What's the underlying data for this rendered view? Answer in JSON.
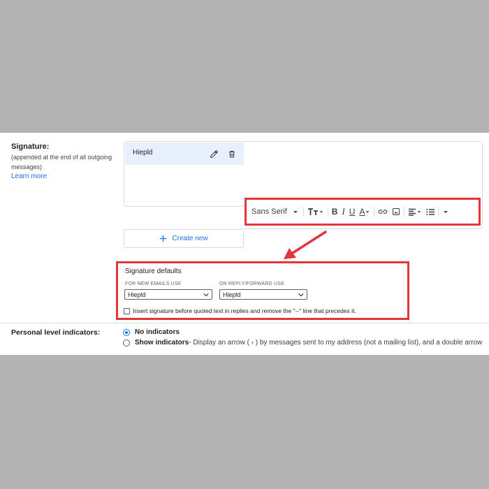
{
  "signature": {
    "label": "Signature:",
    "sublabel": "(appended at the end of all outgoing messages)",
    "learn_more": "Learn more",
    "items": [
      {
        "name": "Hiepld"
      }
    ],
    "create_new": "Create new",
    "toolbar": {
      "font": "Sans Serif",
      "bold": "B",
      "italic": "I",
      "underline": "U",
      "text_color": "A"
    }
  },
  "defaults": {
    "title": "Signature defaults",
    "new_emails_label": "FOR NEW EMAILS USE",
    "new_emails_value": "Hiepld",
    "reply_label": "ON REPLY/FORWARD USE",
    "reply_value": "Hiepld",
    "insert_before_quoted": "Insert signature before quoted text in replies and remove the \"--\" line that precedes it.",
    "insert_before_quoted_checked": false
  },
  "personal_level": {
    "label": "Personal level indicators:",
    "options": [
      {
        "label": "No indicators",
        "desc": "",
        "selected": true
      },
      {
        "label": "Show indicators",
        "desc": " - Display an arrow ( › ) by messages sent to my address (not a mailing list), and a double arrow",
        "selected": false
      }
    ]
  },
  "colors": {
    "highlight_red": "#e2363b",
    "accent_blue": "#1a73e8",
    "selected_item_bg": "#e8f0fe"
  }
}
